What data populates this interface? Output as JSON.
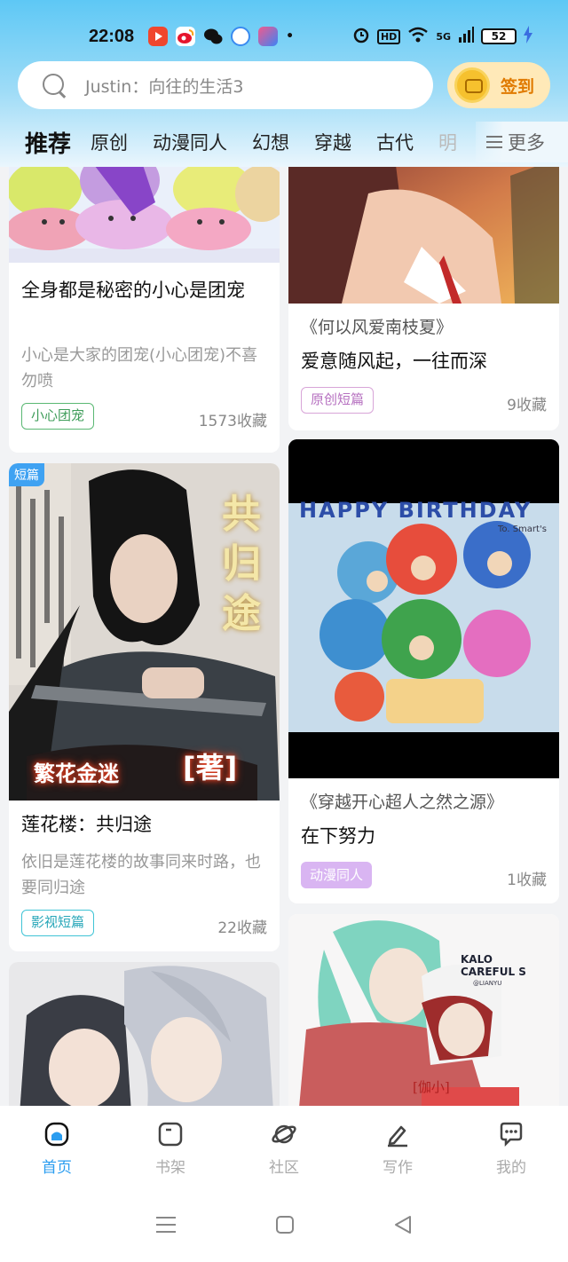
{
  "status_bar": {
    "time": "22:08",
    "network": "HD",
    "signal": "5G",
    "battery": "52"
  },
  "search": {
    "placeholder": "Justin：向往的生活3",
    "signin_label": "签到"
  },
  "tabs": [
    "推荐",
    "原创",
    "动漫同人",
    "幻想",
    "穿越",
    "古代",
    "明"
  ],
  "more_label": "更多",
  "cards": [
    {
      "title": "全身都是秘密的小心是团宠",
      "excerpt": "小心是大家的团宠(小心团宠)不喜勿喷",
      "tag": "小心团宠",
      "favorites": "1573收藏"
    },
    {
      "book": "《何以风爱南枝夏》",
      "title": "爱意随风起，一往而深",
      "tag": "原创短篇",
      "favorites": "9收藏"
    },
    {
      "badge": "短篇",
      "cover_text": "共归途",
      "cover_subtitle": "繁花金迷",
      "cover_stamp": "著",
      "title": "莲花楼：共归途",
      "excerpt": "依旧是莲花楼的故事同来时路，也要同归途",
      "tag": "影视短篇",
      "favorites": "22收藏"
    },
    {
      "cover_text": "HAPPY BIRTHDAY",
      "cover_note": "To. Smart's",
      "book": "《穿越开心超人之然之源》",
      "title": "在下努力",
      "tag": "动漫同人",
      "favorites": "1收藏"
    },
    {
      "cover_text": "KALO CAREFUL S",
      "cover_note": "@LIANYU",
      "cover_stamp": "[伽小]"
    },
    {}
  ],
  "bottom_nav": [
    {
      "label": "首页",
      "active": true
    },
    {
      "label": "书架",
      "active": false
    },
    {
      "label": "社区",
      "active": false
    },
    {
      "label": "写作",
      "active": false
    },
    {
      "label": "我的",
      "active": false
    }
  ],
  "colors": {
    "accent": "#2b9df0",
    "signin_bg": "#ffe9b8",
    "signin_text": "#e07a00"
  }
}
